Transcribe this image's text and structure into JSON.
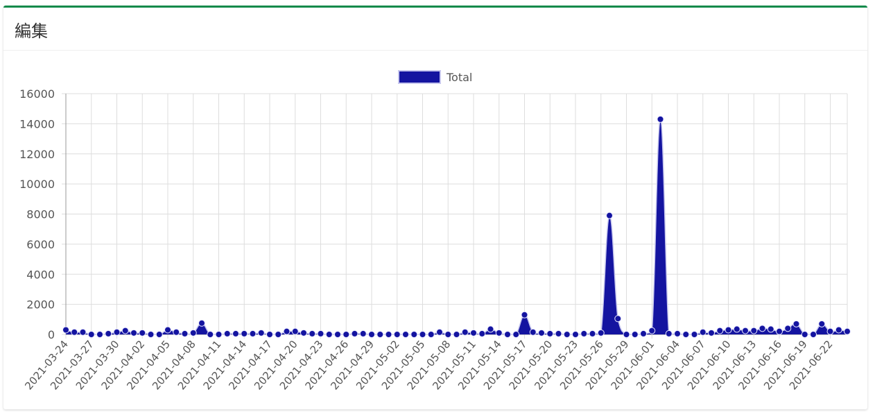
{
  "panel": {
    "title": "編集"
  },
  "colors": {
    "accent": "#0f8a4a",
    "series": "#1414a0"
  },
  "chart_data": {
    "type": "area",
    "title": "",
    "xlabel": "",
    "ylabel": "",
    "ylim": [
      0,
      16000
    ],
    "yticks": [
      0,
      2000,
      4000,
      6000,
      8000,
      10000,
      12000,
      14000,
      16000
    ],
    "grid": true,
    "legend": "top-center",
    "x_tick_every": 3,
    "x": [
      "2021-03-24",
      "2021-03-25",
      "2021-03-26",
      "2021-03-27",
      "2021-03-28",
      "2021-03-29",
      "2021-03-30",
      "2021-03-31",
      "2021-04-01",
      "2021-04-02",
      "2021-04-03",
      "2021-04-04",
      "2021-04-05",
      "2021-04-06",
      "2021-04-07",
      "2021-04-08",
      "2021-04-09",
      "2021-04-10",
      "2021-04-11",
      "2021-04-12",
      "2021-04-13",
      "2021-04-14",
      "2021-04-15",
      "2021-04-16",
      "2021-04-17",
      "2021-04-18",
      "2021-04-19",
      "2021-04-20",
      "2021-04-21",
      "2021-04-22",
      "2021-04-23",
      "2021-04-24",
      "2021-04-25",
      "2021-04-26",
      "2021-04-27",
      "2021-04-28",
      "2021-04-29",
      "2021-04-30",
      "2021-05-01",
      "2021-05-02",
      "2021-05-03",
      "2021-05-04",
      "2021-05-05",
      "2021-05-06",
      "2021-05-07",
      "2021-05-08",
      "2021-05-09",
      "2021-05-10",
      "2021-05-11",
      "2021-05-12",
      "2021-05-13",
      "2021-05-14",
      "2021-05-15",
      "2021-05-16",
      "2021-05-17",
      "2021-05-18",
      "2021-05-19",
      "2021-05-20",
      "2021-05-21",
      "2021-05-22",
      "2021-05-23",
      "2021-05-24",
      "2021-05-25",
      "2021-05-26",
      "2021-05-27",
      "2021-05-28",
      "2021-05-29",
      "2021-05-30",
      "2021-05-31",
      "2021-06-01",
      "2021-06-02",
      "2021-06-03",
      "2021-06-04",
      "2021-06-05",
      "2021-06-06",
      "2021-06-07",
      "2021-06-08",
      "2021-06-09",
      "2021-06-10",
      "2021-06-11",
      "2021-06-12",
      "2021-06-13",
      "2021-06-14",
      "2021-06-15",
      "2021-06-16",
      "2021-06-17",
      "2021-06-18",
      "2021-06-19",
      "2021-06-20",
      "2021-06-21",
      "2021-06-22",
      "2021-06-23",
      "2021-06-24"
    ],
    "series": [
      {
        "name": "Total",
        "color": "#1414a0",
        "values": [
          300,
          150,
          150,
          0,
          0,
          50,
          150,
          250,
          100,
          100,
          0,
          0,
          300,
          150,
          50,
          100,
          750,
          0,
          0,
          50,
          50,
          50,
          50,
          100,
          0,
          0,
          200,
          200,
          100,
          50,
          50,
          0,
          0,
          0,
          50,
          50,
          0,
          0,
          0,
          0,
          0,
          0,
          0,
          0,
          150,
          0,
          0,
          150,
          100,
          50,
          350,
          100,
          0,
          0,
          1300,
          150,
          100,
          50,
          50,
          0,
          0,
          50,
          50,
          100,
          7900,
          1050,
          0,
          0,
          50,
          250,
          14300,
          50,
          50,
          0,
          0,
          150,
          100,
          250,
          300,
          350,
          250,
          250,
          400,
          350,
          200,
          400,
          700,
          0,
          0,
          700,
          200,
          300,
          200
        ]
      }
    ]
  }
}
